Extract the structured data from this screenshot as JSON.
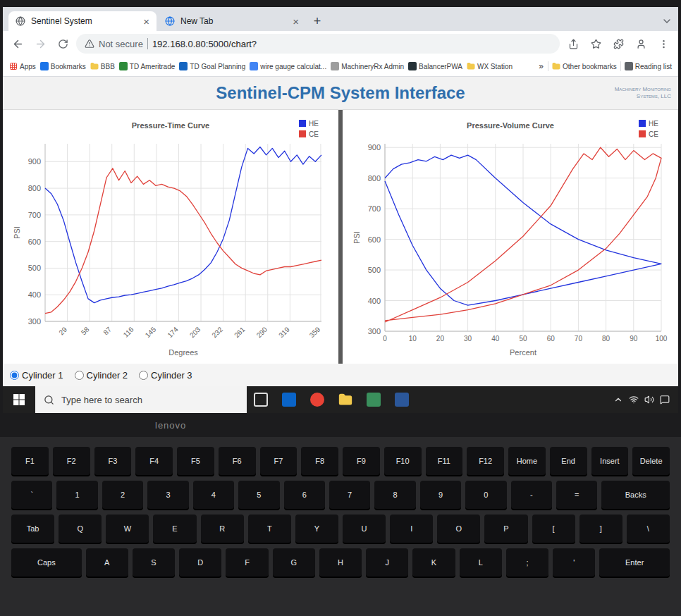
{
  "browser": {
    "tabs": [
      {
        "label": "Sentinel System",
        "selected": true,
        "close": "×"
      },
      {
        "label": "New Tab",
        "selected": false,
        "close": "×"
      }
    ],
    "new_tab": "+",
    "address": {
      "security": "Not secure",
      "url": "192.168.0.80:5000/chart?"
    },
    "bookmarks": [
      {
        "label": "Apps",
        "kind": "apps",
        "color": "#e94235"
      },
      {
        "label": "Bookmarks",
        "kind": "site",
        "color": "#1a73e8"
      },
      {
        "label": "BBB",
        "kind": "folder",
        "color": "#f2c94c"
      },
      {
        "label": "TD Ameritrade",
        "kind": "site",
        "color": "#2e8b3a"
      },
      {
        "label": "TD Goal Planning",
        "kind": "site",
        "color": "#1565c0"
      },
      {
        "label": "wire gauge calculat...",
        "kind": "site",
        "color": "#4285f4"
      },
      {
        "label": "MachineryRx Admin",
        "kind": "site",
        "color": "#9e9e9e"
      },
      {
        "label": "BalancerPWA",
        "kind": "site",
        "color": "#263238"
      },
      {
        "label": "WX Station",
        "kind": "folder",
        "color": "#f2c94c"
      }
    ],
    "overflow": "»",
    "other_bookmarks": "Other bookmarks",
    "reading_list": "Reading list"
  },
  "page": {
    "title": "Sentinel-CPM System Interface",
    "logo": "Machinery Monitoring Systems, LLC"
  },
  "charts": [
    {
      "title": "Pressure-Time Curve",
      "x_label": "Degrees",
      "y_label": "PSI",
      "x_ticks": [
        "29",
        "58",
        "87",
        "116",
        "145",
        "174",
        "203",
        "232",
        "261",
        "290",
        "319",
        "359"
      ],
      "y_ticks": [
        "300",
        "400",
        "500",
        "600",
        "700",
        "800",
        "900"
      ],
      "series": [
        {
          "name": "HE",
          "color": "#2233dd",
          "x": [
            0,
            8,
            16,
            24,
            32,
            40,
            48,
            56,
            64,
            72,
            80,
            88,
            96,
            104,
            112,
            120,
            128,
            136,
            144,
            152,
            160,
            168,
            176,
            184,
            192,
            200,
            208,
            216,
            224,
            232,
            240,
            248,
            256,
            264,
            272,
            280,
            288,
            296,
            304,
            312,
            320,
            328,
            336,
            344,
            352,
            360
          ],
          "values": [
            800,
            780,
            740,
            680,
            600,
            520,
            450,
            385,
            370,
            380,
            385,
            390,
            392,
            398,
            400,
            405,
            410,
            415,
            420,
            425,
            432,
            438,
            445,
            452,
            462,
            475,
            495,
            520,
            560,
            610,
            680,
            780,
            880,
            950,
            930,
            955,
            925,
            950,
            915,
            940,
            900,
            925,
            890,
            920,
            900,
            925
          ]
        },
        {
          "name": "CE",
          "color": "#e0413a",
          "x": [
            0,
            8,
            16,
            24,
            32,
            40,
            48,
            56,
            64,
            72,
            80,
            88,
            96,
            104,
            112,
            120,
            128,
            136,
            144,
            152,
            160,
            168,
            176,
            184,
            192,
            200,
            208,
            216,
            224,
            232,
            240,
            248,
            256,
            264,
            272,
            280,
            288,
            296,
            304,
            312,
            320,
            328,
            336,
            344,
            352,
            360
          ],
          "values": [
            330,
            335,
            355,
            380,
            410,
            450,
            500,
            560,
            640,
            740,
            840,
            875,
            830,
            865,
            820,
            845,
            815,
            830,
            810,
            815,
            805,
            800,
            790,
            770,
            740,
            705,
            670,
            630,
            595,
            565,
            540,
            515,
            500,
            490,
            480,
            475,
            490,
            495,
            500,
            505,
            505,
            510,
            515,
            520,
            525,
            530
          ]
        }
      ]
    },
    {
      "title": "Pressure-Volume Curve",
      "x_label": "Percent",
      "y_label": "PSI",
      "x_ticks": [
        "0",
        "10",
        "20",
        "30",
        "40",
        "50",
        "60",
        "70",
        "80",
        "90",
        "100"
      ],
      "y_ticks": [
        "300",
        "400",
        "500",
        "600",
        "700",
        "800",
        "900"
      ],
      "series": [
        {
          "name": "HE",
          "color": "#2233dd",
          "x": [
            0,
            3,
            6,
            9,
            12,
            15,
            18,
            21,
            24,
            27,
            30,
            33,
            40,
            50,
            60,
            70,
            80,
            90,
            100,
            90,
            80,
            70,
            60,
            50,
            40,
            30,
            25,
            20,
            15,
            10,
            5,
            0
          ],
          "values": [
            800,
            830,
            845,
            850,
            860,
            855,
            870,
            860,
            875,
            865,
            875,
            860,
            800,
            720,
            650,
            600,
            565,
            540,
            520,
            500,
            480,
            460,
            440,
            420,
            400,
            385,
            400,
            440,
            500,
            580,
            680,
            790
          ]
        },
        {
          "name": "CE",
          "color": "#e0413a",
          "x": [
            0,
            10,
            20,
            30,
            40,
            50,
            60,
            68,
            72,
            75,
            78,
            81,
            84,
            87,
            90,
            94,
            97,
            100,
            98,
            95,
            90,
            85,
            80,
            70,
            60,
            50,
            40,
            30,
            20,
            10,
            0
          ],
          "values": [
            330,
            370,
            410,
            460,
            530,
            610,
            710,
            830,
            880,
            860,
            900,
            870,
            895,
            860,
            890,
            860,
            880,
            865,
            800,
            740,
            680,
            620,
            570,
            500,
            450,
            420,
            390,
            370,
            355,
            345,
            335
          ]
        }
      ]
    }
  ],
  "cylinders": [
    {
      "label": "Cylinder 1",
      "selected": true
    },
    {
      "label": "Cylinder 2",
      "selected": false
    },
    {
      "label": "Cylinder 3",
      "selected": false
    }
  ],
  "taskbar": {
    "search_placeholder": "Type here to search",
    "apps": [
      {
        "kind": "taskview",
        "color": "#dddddd"
      },
      {
        "kind": "app",
        "color": "#0a64c8"
      },
      {
        "kind": "chrome",
        "color": "#e94235"
      },
      {
        "kind": "folder",
        "color": "#f2c94c"
      },
      {
        "kind": "app",
        "color": "#3a8f5c"
      },
      {
        "kind": "app",
        "color": "#2b579a"
      }
    ]
  },
  "laptop": {
    "brand": "lenovo",
    "keys": [
      [
        "F1",
        "F2",
        "F3",
        "F4",
        "F5",
        "F6",
        "F7",
        "F8",
        "F9",
        "F10",
        "F11",
        "F12",
        "Home",
        "End",
        "Insert",
        "Delete"
      ],
      [
        "`",
        "1",
        "2",
        "3",
        "4",
        "5",
        "6",
        "7",
        "8",
        "9",
        "0",
        "-",
        "=",
        "Backs"
      ],
      [
        "Tab",
        "Q",
        "W",
        "E",
        "R",
        "T",
        "Y",
        "U",
        "I",
        "O",
        "P",
        "[",
        "]",
        "\\"
      ],
      [
        "Caps",
        "A",
        "S",
        "D",
        "F",
        "G",
        "H",
        "J",
        "K",
        "L",
        ";",
        "'",
        "Enter"
      ]
    ]
  }
}
